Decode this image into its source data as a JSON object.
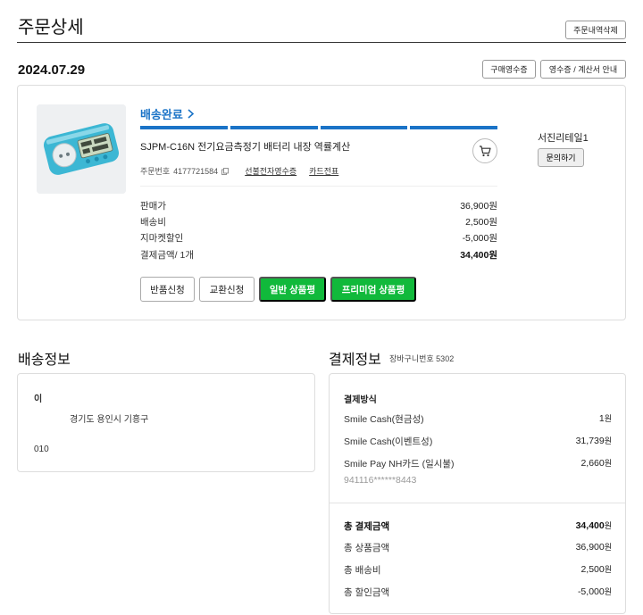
{
  "header": {
    "title": "주문상세",
    "delete_button": "주문내역삭제"
  },
  "order": {
    "date": "2024.07.29",
    "receipt_button": "구매영수증",
    "tax_button": "영수증 / 계산서 안내",
    "status": "배송완료",
    "product_name": "SJPM-C16N 전기요금측정기 배터리 내장 역률계산",
    "order_number_label": "주문번호",
    "order_number": "4177721584",
    "link_prepaid_receipt": "선불전자영수증",
    "link_card_slip": "카드전표",
    "prices": [
      {
        "label": "판매가",
        "value": "36,900원"
      },
      {
        "label": "배송비",
        "value": "2,500원"
      },
      {
        "label": "지마켓할인",
        "value": "-5,000원"
      },
      {
        "label": "결제금액/ 1개",
        "value": "34,400원"
      }
    ],
    "buttons": {
      "return": "반품신청",
      "exchange": "교환신청",
      "review": "일반 상품평",
      "premium_review": "프리미엄 상품평"
    },
    "seller_name": "서진리테일1",
    "ask_button": "문의하기",
    "progress_steps": 4,
    "progress_completed": 4
  },
  "shipping": {
    "title": "배송정보",
    "name": "이",
    "address": "경기도 용인시 기흥구",
    "phone": "010"
  },
  "payment": {
    "title": "결제정보",
    "cart_number": "장바구니번호 5302",
    "method_label": "결제방식",
    "methods": [
      {
        "label": "Smile Cash(현금성)",
        "value": "1",
        "unit": "원"
      },
      {
        "label": "Smile Cash(이벤트성)",
        "value": "31,739",
        "unit": "원"
      },
      {
        "label": "Smile Pay NH카드 (일시불)",
        "value": "2,660",
        "unit": "원"
      }
    ],
    "card_number": "941116******8443",
    "totals": [
      {
        "label": "총 결제금액",
        "value": "34,400",
        "unit": "원"
      },
      {
        "label": "총 상품금액",
        "value": "36,900",
        "unit": "원"
      },
      {
        "label": "총 배송비",
        "value": "2,500",
        "unit": "원"
      },
      {
        "label": "총 할인금액",
        "value": "-5,000",
        "unit": "원"
      }
    ]
  },
  "colors": {
    "accent_blue": "#1a73c7",
    "green": "#11b93b"
  }
}
